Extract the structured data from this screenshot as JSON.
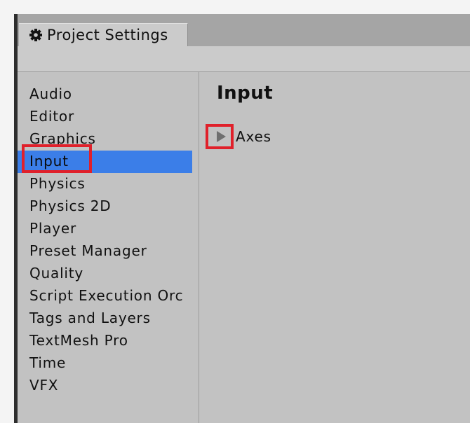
{
  "window": {
    "tab_title": "Project Settings",
    "tab_icon": "gear-icon"
  },
  "sidebar": {
    "selected": "Input",
    "items": [
      {
        "label": "Audio"
      },
      {
        "label": "Editor"
      },
      {
        "label": "Graphics"
      },
      {
        "label": "Input"
      },
      {
        "label": "Physics"
      },
      {
        "label": "Physics 2D"
      },
      {
        "label": "Player"
      },
      {
        "label": "Preset Manager"
      },
      {
        "label": "Quality"
      },
      {
        "label": "Script Execution Orc"
      },
      {
        "label": "Tags and Layers"
      },
      {
        "label": "TextMesh Pro"
      },
      {
        "label": "Time"
      },
      {
        "label": "VFX"
      }
    ]
  },
  "content": {
    "title": "Input",
    "foldout": {
      "label": "Axes",
      "icon": "triangle-right-icon",
      "expanded": false
    }
  },
  "colors": {
    "selection": "#3b7ee8",
    "highlight": "#e0202a",
    "panel": "#c2c2c2"
  }
}
